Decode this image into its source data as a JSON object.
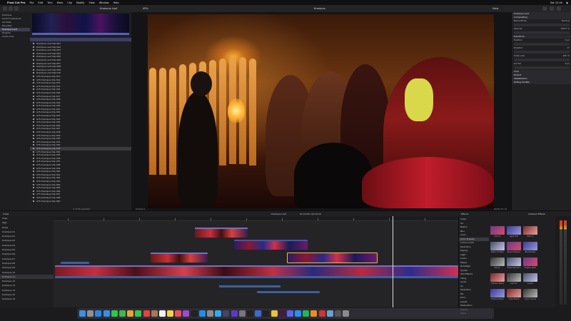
{
  "menubar": {
    "apple": "",
    "items": [
      "Final Cut Pro",
      "File",
      "Edit",
      "Trim",
      "Mark",
      "Clip",
      "Modify",
      "View",
      "Window",
      "Help"
    ],
    "right": [
      "Sat 12:40",
      "◉"
    ]
  },
  "toolbar": {
    "library_label": "Libraries",
    "browser_title": "Krampus Lauf",
    "viewer_title": "Krampus",
    "zoom": "45%",
    "view": "View"
  },
  "libraries": {
    "items": [
      "Krampus",
      "Smart Collections",
      "All Video",
      "Favorites",
      "Krampus Lauf",
      "Projects",
      "Audio Only"
    ],
    "selected_index": 4
  },
  "browser": {
    "header": "Krampus Lauf",
    "clips": [
      "Krampus Lauf Clip 001",
      "Krampus Lauf Clip 002",
      "Krampus Lauf Clip 003",
      "Krampus Lauf Clip 004",
      "Krampus Lauf Clip 005",
      "Krampus Lauf Clip 006",
      "Krampus Lauf Clip 007",
      "Krampus Lauf Clip 008",
      "Krampus Lauf Clip 009",
      "Krampus Lauf Clip 010",
      "A7S Krampus Clip 011",
      "A7S Krampus Clip 012",
      "A7S Krampus Clip 013",
      "A7S Krampus Clip 014",
      "A7S Krampus Clip 015",
      "A7S Krampus Clip 016",
      "A7S Krampus Clip 017",
      "A7S Krampus Clip 018",
      "A7S Krampus Clip 019",
      "A7S Krampus Clip 020",
      "A7S Krampus Clip 021",
      "A7S Krampus Clip 022",
      "A7S Krampus Clip 023",
      "A7S Krampus Clip 024",
      "A7S Krampus Clip 025",
      "A7S Krampus Clip 026",
      "A7S Krampus Clip 027",
      "A7S Krampus Clip 028",
      "A7S Krampus Clip 029",
      "A7S Krampus Clip 030",
      "A7S Krampus Clip 031",
      "A7S Krampus Clip 032",
      "A7S Krampus Clip 033",
      "A7S Krampus Clip 034",
      "A7S Krampus Clip 035",
      "A7S Krampus Clip 036",
      "A7S Krampus Clip 037",
      "A7S Krampus Clip 038",
      "A7S Krampus Clip 039",
      "A7S Krampus Clip 040",
      "A7S Krampus Clip 041",
      "A7S Krampus Clip 042",
      "A7S Krampus Clip 043",
      "A7S Krampus Clip 044",
      "A7S Krampus Clip 045",
      "A7S Krampus Clip 046",
      "A7S Krampus Clip 047",
      "A7S Krampus Clip 048",
      "A7S Krampus Clip 049"
    ],
    "selected_index": 32,
    "footer": "1 of 49 selected"
  },
  "viewer": {
    "timecode": "00:00:12:14",
    "footer_left": "Krampus",
    "footer_right": "00:00:12:14"
  },
  "inspector": {
    "title": "Krampus Lauf",
    "rows": [
      {
        "label": "Compositing",
        "value": ""
      },
      {
        "label": "Blend Mode",
        "value": "Normal"
      },
      {
        "label": "Opacity",
        "value": "100.0 %"
      },
      {
        "label": "Transform",
        "value": ""
      },
      {
        "label": "Position",
        "value": "0 px"
      },
      {
        "label": "Rotation",
        "value": "0°"
      },
      {
        "label": "Scale (All)",
        "value": "100 %"
      },
      {
        "label": "Anchor",
        "value": "0 px"
      },
      {
        "label": "Crop",
        "value": ""
      },
      {
        "label": "Distort",
        "value": ""
      },
      {
        "label": "Stabilization",
        "value": ""
      },
      {
        "label": "Rolling Shutter",
        "value": ""
      }
    ]
  },
  "midbar": {
    "index": "Index",
    "project": "Krampus Lauf",
    "duration": "01:12:04 / 04:10:22",
    "effects": "Effects",
    "installed": "Installed Effects"
  },
  "timeline_index": {
    "rows": [
      "Clips",
      "Tags",
      "Roles",
      "Krampus 01",
      "Krampus 02",
      "Krampus 03",
      "Krampus 04",
      "Krampus 05",
      "Krampus 06",
      "Krampus 07",
      "Krampus 08",
      "Krampus 09",
      "Krampus 10",
      "Krampus 11",
      "Krampus 12",
      "Krampus 13",
      "Krampus 14",
      "Krampus 15",
      "Krampus 16"
    ],
    "selected_index": 13
  },
  "effects": {
    "categories": [
      "Video",
      "All",
      "Basics",
      "Blur",
      "Color",
      "Color Presets",
      "Comic Looks",
      "Distortion",
      "Keying",
      "Light",
      "Looks",
      "Masks",
      "Nostalgia",
      "Stylize",
      "Text Effects",
      "Tiling",
      "Audio",
      "All",
      "Distortion",
      "EQ",
      "Echo",
      "Levels",
      "Modulation",
      "Spaces",
      "Voice"
    ],
    "selected_index": 5,
    "thumbs": [
      "50s TV",
      "Aged Film",
      "Bad TV",
      "Black & White",
      "Bleach Bypass",
      "Blockbuster",
      "Bloom",
      "Bokeh Random",
      "Bright Lights",
      "Camera Noise",
      "Cartoon",
      "Censor",
      "Channel Mixer",
      "Color Board",
      "Color Curves"
    ]
  },
  "dock": {
    "icons": [
      "finder-icon",
      "launchpad-icon",
      "safari-icon",
      "mail-icon",
      "messages-icon",
      "maps-icon",
      "photos-icon",
      "facetime-icon",
      "calendar-icon",
      "contacts-icon",
      "reminders-icon",
      "notes-icon",
      "music-icon",
      "podcasts-icon",
      "tv-icon",
      "appstore-icon",
      "settings-icon",
      "photoshop-icon",
      "finalcut-icon",
      "motion-icon",
      "compressor-icon",
      "logic-icon",
      "xcode-icon",
      "terminal-icon",
      "chrome-icon",
      "slack-icon",
      "discord-icon",
      "zoom-icon",
      "spotify-icon",
      "vlc-icon",
      "acrobat-icon",
      "preview-icon",
      "activity-icon",
      "trash-icon"
    ],
    "colors": [
      "#3a8ee8",
      "#8f8f95",
      "#2a84e8",
      "#3a8ee8",
      "#33c748",
      "#3fb850",
      "#e9a13a",
      "#33c748",
      "#e84040",
      "#a07a5a",
      "#f2f2f2",
      "#f2d24a",
      "#f04a5a",
      "#9b4ad8",
      "#222222",
      "#1c8ef0",
      "#8a8a90",
      "#31a8ff",
      "#444466",
      "#5a3ac8",
      "#777777",
      "#222222",
      "#3a6ad8",
      "#222222",
      "#e8c23a",
      "#4a154b",
      "#5865f2",
      "#2d8cff",
      "#1db954",
      "#f08a20",
      "#d63030",
      "#6aa0d8",
      "#555555",
      "#8a8a90"
    ]
  }
}
